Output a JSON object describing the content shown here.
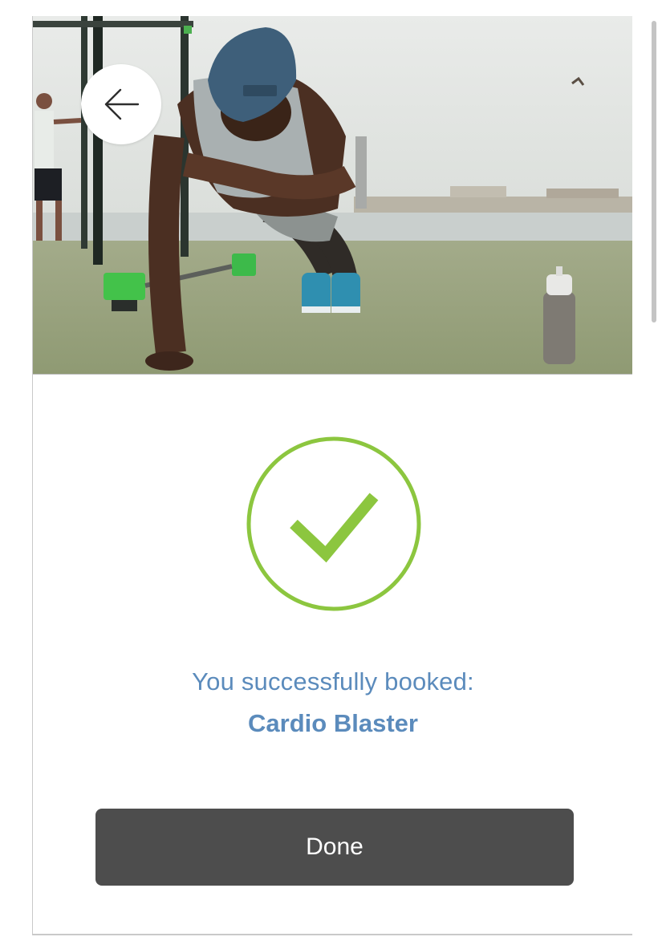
{
  "hero": {
    "back_icon": "arrow-left-icon"
  },
  "confirmation": {
    "icon": "check-circle-icon",
    "accent_color": "#8cc63f",
    "message": "You successfully booked:",
    "class_name": "Cardio Blaster"
  },
  "actions": {
    "done_label": "Done"
  },
  "colors": {
    "text_accent": "#5b8bbc",
    "button_bg": "#4d4d4d"
  }
}
